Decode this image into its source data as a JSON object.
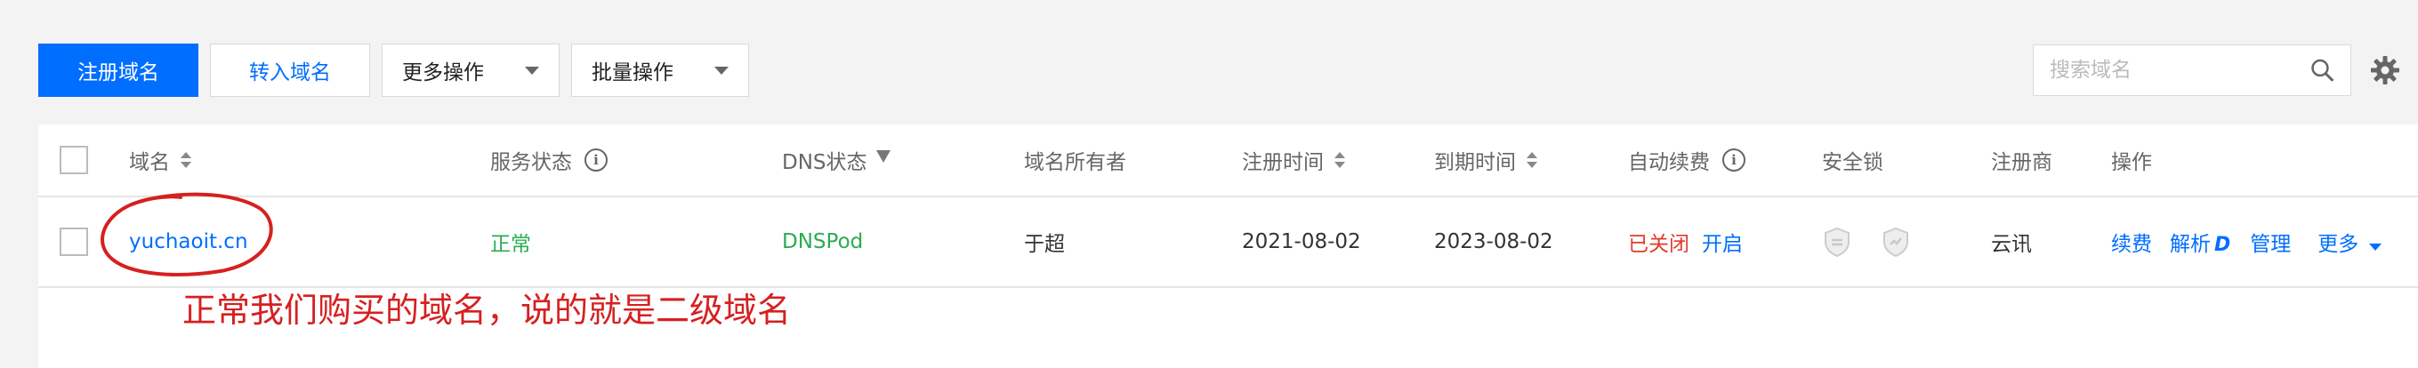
{
  "toolbar": {
    "register_label": "注册域名",
    "transfer_label": "转入域名",
    "more_ops_label": "更多操作",
    "batch_ops_label": "批量操作"
  },
  "search": {
    "placeholder": "搜索域名"
  },
  "table": {
    "headers": {
      "domain": "域名",
      "service_status": "服务状态",
      "dns_status": "DNS状态",
      "owner": "域名所有者",
      "register_time": "注册时间",
      "expire_time": "到期时间",
      "auto_renew": "自动续费",
      "security_lock": "安全锁",
      "registrar": "注册商",
      "actions": "操作"
    },
    "rows": [
      {
        "domain": "yuchaoit.cn",
        "service_status": "正常",
        "dns_status": "DNSPod",
        "owner": "于超",
        "register_time": "2021-08-02",
        "expire_time": "2023-08-02",
        "auto_renew_state": "已关闭",
        "auto_renew_toggle": "开启",
        "registrar": "云讯",
        "action_renew": "续费",
        "action_resolve": "解析",
        "action_manage": "管理",
        "action_more": "更多"
      }
    ]
  },
  "annotation": "正常我们购买的域名，说的就是二级域名",
  "colors": {
    "primary": "#006eff",
    "success": "#2bab53",
    "danger": "#e43a2b",
    "annotation": "#d62020"
  }
}
